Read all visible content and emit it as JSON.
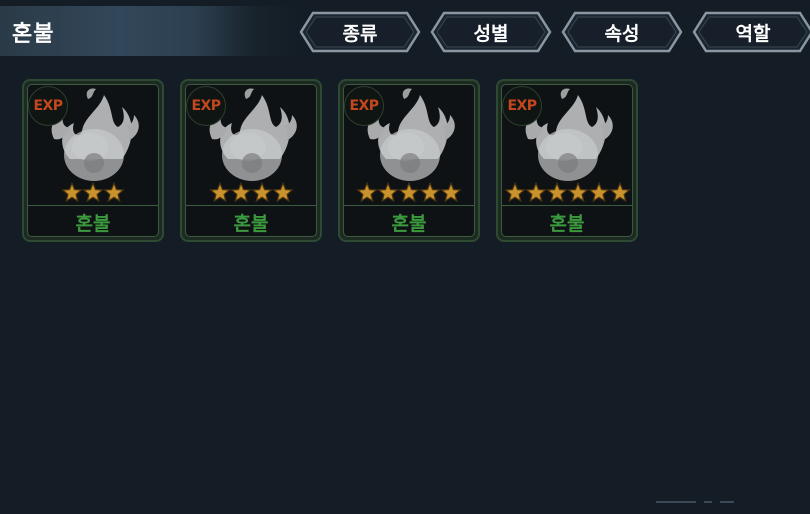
{
  "header": {
    "title": "혼불"
  },
  "filters": [
    {
      "label": "종류"
    },
    {
      "label": "성별"
    },
    {
      "label": "속성"
    },
    {
      "label": "역할"
    }
  ],
  "cards": [
    {
      "name": "혼불",
      "badge": "EXP",
      "stars": 3
    },
    {
      "name": "혼불",
      "badge": "EXP",
      "stars": 4
    },
    {
      "name": "혼불",
      "badge": "EXP",
      "stars": 5
    },
    {
      "name": "혼불",
      "badge": "EXP",
      "stars": 6
    }
  ],
  "colors": {
    "background": "#141d25",
    "card_name": "#3c9a3e",
    "exp_badge": "#c4471e",
    "star": "#c9922c"
  },
  "icons": {
    "card_art": "spirit-flame-icon",
    "rating": "star-icon"
  }
}
